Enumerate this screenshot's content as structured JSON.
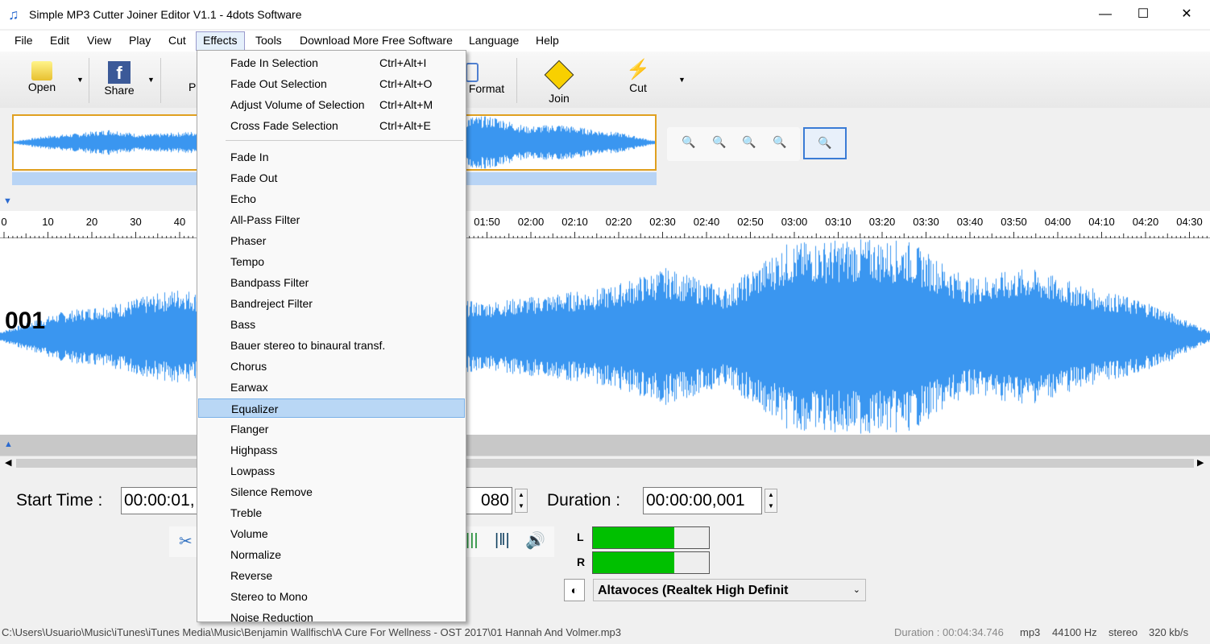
{
  "window": {
    "title": "Simple MP3 Cutter Joiner Editor V1.1 - 4dots Software",
    "minimize": "—",
    "maximize": "☐",
    "close": "✕"
  },
  "menubar": [
    "File",
    "Edit",
    "View",
    "Play",
    "Cut",
    "Effects",
    "Tools",
    "Download More Free Software",
    "Language",
    "Help"
  ],
  "toolbar": {
    "open": "Open",
    "share": "Share",
    "partial": "P",
    "format": "Format",
    "join": "Join",
    "cut": "Cut"
  },
  "effects_menu": {
    "selection_items": [
      {
        "label": "Fade In Selection",
        "shortcut": "Ctrl+Alt+I"
      },
      {
        "label": "Fade Out Selection",
        "shortcut": "Ctrl+Alt+O"
      },
      {
        "label": "Adjust Volume of Selection",
        "shortcut": "Ctrl+Alt+M"
      },
      {
        "label": "Cross Fade Selection",
        "shortcut": "Ctrl+Alt+E"
      }
    ],
    "items": [
      "Fade In",
      "Fade Out",
      "Echo",
      "All-Pass Filter",
      "Phaser",
      "Tempo",
      "Bandpass Filter",
      "Bandreject Filter",
      "Bass",
      "Bauer stereo to binaural transf.",
      "Chorus",
      "Earwax",
      "Equalizer",
      "Flanger",
      "Highpass",
      "Lowpass",
      "Silence Remove",
      "Treble",
      "Volume",
      "Normalize",
      "Reverse",
      "Stereo to Mono",
      "Noise Reduction"
    ],
    "highlighted": "Equalizer"
  },
  "ruler": {
    "labels_left": [
      "0",
      "10",
      "20",
      "30",
      "40"
    ],
    "labels_right": [
      "01:50",
      "02:00",
      "02:10",
      "02:20",
      "02:30",
      "02:40",
      "02:50",
      "03:00",
      "03:10",
      "03:20",
      "03:30",
      "03:40",
      "03:50",
      "04:00",
      "04:10",
      "04:20",
      "04:30"
    ]
  },
  "track_label": "001",
  "times": {
    "start_label": "Start Time :",
    "start_value": "00:00:01,",
    "end_value_partial": "080",
    "duration_label": "Duration :",
    "duration_value": "00:00:00,001"
  },
  "meters": {
    "left_label": "L",
    "right_label": "R",
    "left_level": 0.7,
    "right_level": 0.7
  },
  "device": "Altavoces (Realtek High Definit",
  "status": {
    "path": "C:\\Users\\Usuario\\Music\\iTunes\\iTunes Media\\Music\\Benjamin Wallfisch\\A Cure For Wellness - OST 2017\\01 Hannah And Volmer.mp3",
    "duration": "Duration : 00:04:34.746",
    "format": "mp3",
    "rate": "44100 Hz",
    "channels": "stereo",
    "bitrate": "320 kb/s"
  },
  "colors": {
    "waveform": "#3a96f0",
    "selection_border": "#e0a020",
    "meter": "#00c000",
    "menu_highlight": "#b9d7f5"
  }
}
